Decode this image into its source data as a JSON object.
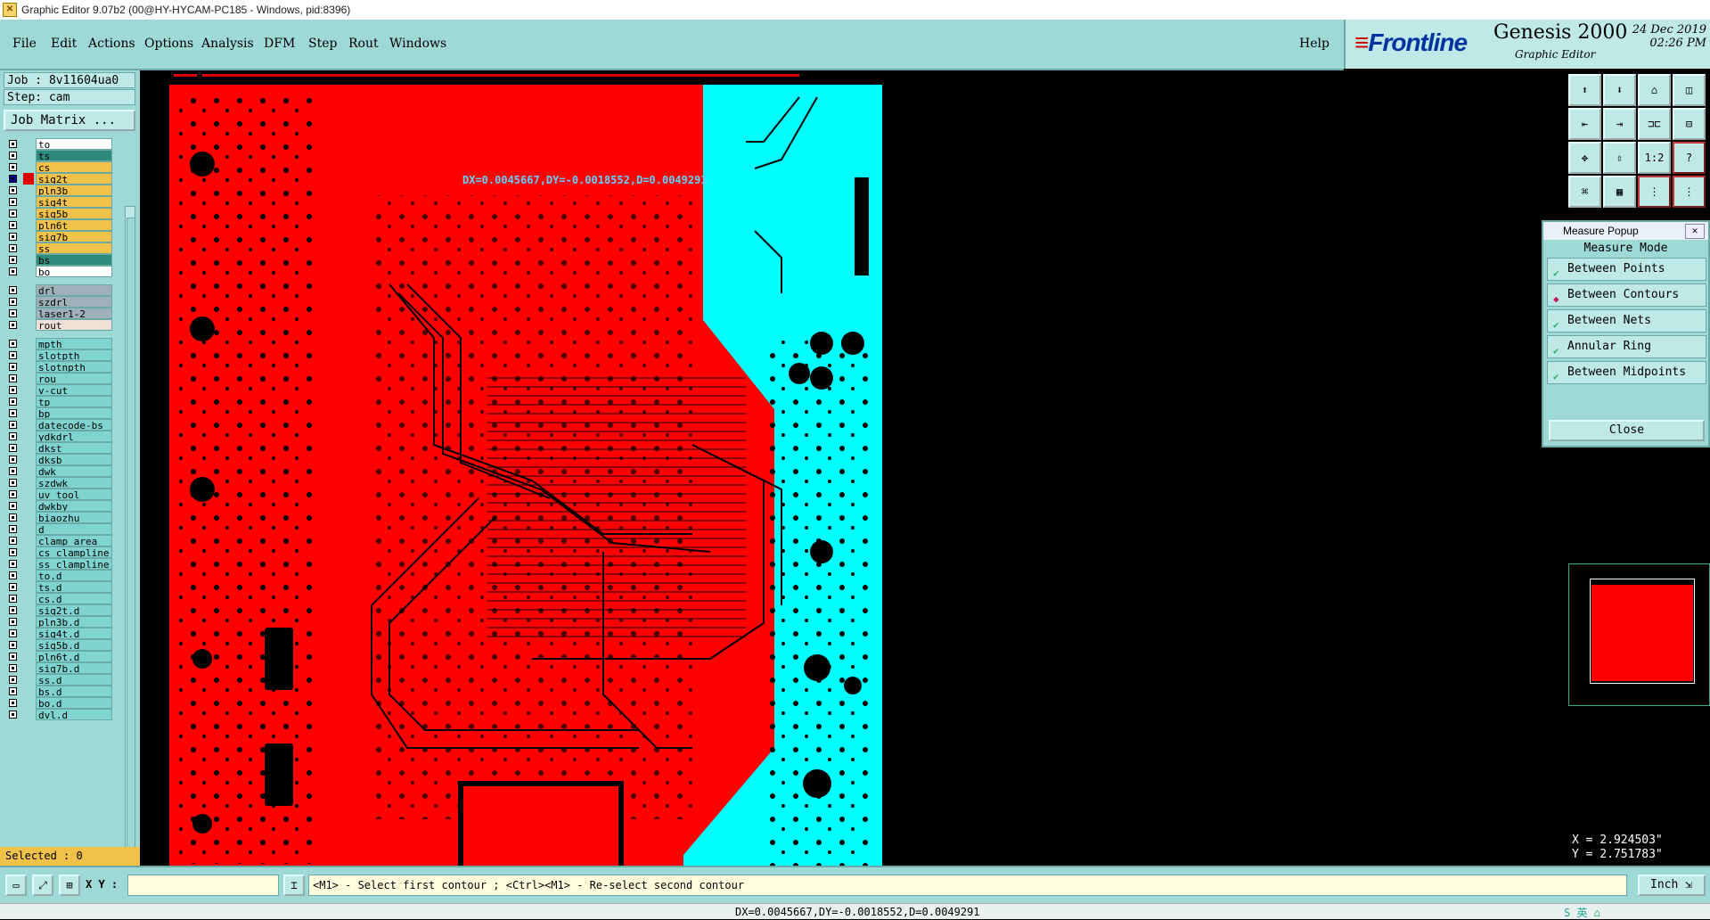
{
  "window": {
    "title": "Graphic Editor 9.07b2 (00@HY-HYCAM-PC185 - Windows, pid:8396)"
  },
  "menu": {
    "items": [
      "File",
      "Edit",
      "Actions",
      "Options",
      "Analysis",
      "DFM",
      "Step",
      "Rout",
      "Windows"
    ],
    "help": "Help"
  },
  "brand": {
    "logo": "Frontline",
    "product": "Genesis 2000",
    "subtitle": "Graphic Editor",
    "date": "24 Dec 2019",
    "time": "02:26 PM"
  },
  "job": {
    "job_label": "Job : 8v11604ua0",
    "step_label": "Step: cam",
    "matrix_button": "Job Matrix ..."
  },
  "layers": [
    {
      "name": "to",
      "color": "#ffffff"
    },
    {
      "name": "ts",
      "color": "#2e8b7a"
    },
    {
      "name": "cs",
      "color": "#f0c24a"
    },
    {
      "name": "sig2t",
      "color": "#f0c24a"
    },
    {
      "name": "pln3b",
      "color": "#f0c24a"
    },
    {
      "name": "sig4t",
      "color": "#f0c24a"
    },
    {
      "name": "sig5b",
      "color": "#f0c24a"
    },
    {
      "name": "pln6t",
      "color": "#f0c24a"
    },
    {
      "name": "sig7b",
      "color": "#f0c24a"
    },
    {
      "name": "ss",
      "color": "#f0c24a"
    },
    {
      "name": "bs",
      "color": "#2e8b7a"
    },
    {
      "name": "bo",
      "color": "#ffffff"
    },
    {
      "name": "drl",
      "color": "#9fb0b8"
    },
    {
      "name": "szdrl",
      "color": "#9fb0b8"
    },
    {
      "name": "laser1-2",
      "color": "#9fb0b8"
    },
    {
      "name": "rout",
      "color": "#f0e0d8"
    },
    {
      "name": "mpth",
      "color": "#7fd4cf"
    },
    {
      "name": "slotpth",
      "color": "#7fd4cf"
    },
    {
      "name": "slotnpth",
      "color": "#7fd4cf"
    },
    {
      "name": "rou",
      "color": "#7fd4cf"
    },
    {
      "name": "v-cut",
      "color": "#7fd4cf"
    },
    {
      "name": "tp",
      "color": "#7fd4cf"
    },
    {
      "name": "bp",
      "color": "#7fd4cf"
    },
    {
      "name": "datecode-bs",
      "color": "#7fd4cf"
    },
    {
      "name": "ydkdrl",
      "color": "#7fd4cf"
    },
    {
      "name": "dkst",
      "color": "#7fd4cf"
    },
    {
      "name": "dksb",
      "color": "#7fd4cf"
    },
    {
      "name": "dwk",
      "color": "#7fd4cf"
    },
    {
      "name": "szdwk",
      "color": "#7fd4cf"
    },
    {
      "name": "uv_tool",
      "color": "#7fd4cf"
    },
    {
      "name": "dwkby",
      "color": "#7fd4cf"
    },
    {
      "name": "biaozhu",
      "color": "#7fd4cf"
    },
    {
      "name": "d",
      "color": "#7fd4cf"
    },
    {
      "name": "clamp_area",
      "color": "#7fd4cf"
    },
    {
      "name": "cs_clampline",
      "color": "#7fd4cf"
    },
    {
      "name": "ss_clampline",
      "color": "#7fd4cf"
    },
    {
      "name": "to.d",
      "color": "#7fd4cf"
    },
    {
      "name": "ts.d",
      "color": "#7fd4cf"
    },
    {
      "name": "cs.d",
      "color": "#7fd4cf"
    },
    {
      "name": "sig2t.d",
      "color": "#7fd4cf"
    },
    {
      "name": "pln3b.d",
      "color": "#7fd4cf"
    },
    {
      "name": "sig4t.d",
      "color": "#7fd4cf"
    },
    {
      "name": "sig5b.d",
      "color": "#7fd4cf"
    },
    {
      "name": "pln6t.d",
      "color": "#7fd4cf"
    },
    {
      "name": "sig7b.d",
      "color": "#7fd4cf"
    },
    {
      "name": "ss.d",
      "color": "#7fd4cf"
    },
    {
      "name": "bs.d",
      "color": "#7fd4cf"
    },
    {
      "name": "bo.d",
      "color": "#7fd4cf"
    },
    {
      "name": "dvl.d",
      "color": "#7fd4cf"
    }
  ],
  "selected_label": "Selected : 0",
  "canvas": {
    "measure_readout": "DX=0.0045667,DY=-0.0018552,D=0.0049291",
    "colors": {
      "board": "#ff0000",
      "copper_free": "#00ffff",
      "background": "#000000"
    }
  },
  "measure_popup": {
    "title": "Measure Popup",
    "heading": "Measure Mode",
    "options": [
      {
        "label": "Between Points",
        "selected": false
      },
      {
        "label": "Between Contours",
        "selected": true
      },
      {
        "label": "Between Nets",
        "selected": false
      },
      {
        "label": "Annular Ring",
        "selected": false
      },
      {
        "label": "Between Midpoints",
        "selected": false
      }
    ],
    "close_label": "Close"
  },
  "toolbar_icons": [
    "home-icon",
    "save-icon",
    "house-icon",
    "window-icon",
    "zoom-left-icon",
    "zoom-right-icon",
    "fit-icon",
    "split-icon",
    "pan-icon",
    "center-icon",
    "ratio-icon",
    "help-icon",
    "snap-icon",
    "grid-icon",
    "layers-icon",
    "step-icon"
  ],
  "toolbar_labels": {
    "ratio": "1:2",
    "help": "?"
  },
  "coordinates": {
    "x": "X = 2.924503\"",
    "y": "Y = 2.751783\""
  },
  "status": {
    "xy_label": "X Y :",
    "message": "<M1> - Select first contour ; <Ctrl><M1> - Re-select second contour",
    "unit": "Inch"
  },
  "bottom": {
    "readout": "DX=0.0045667,DY=-0.0018552,D=0.0049291"
  }
}
